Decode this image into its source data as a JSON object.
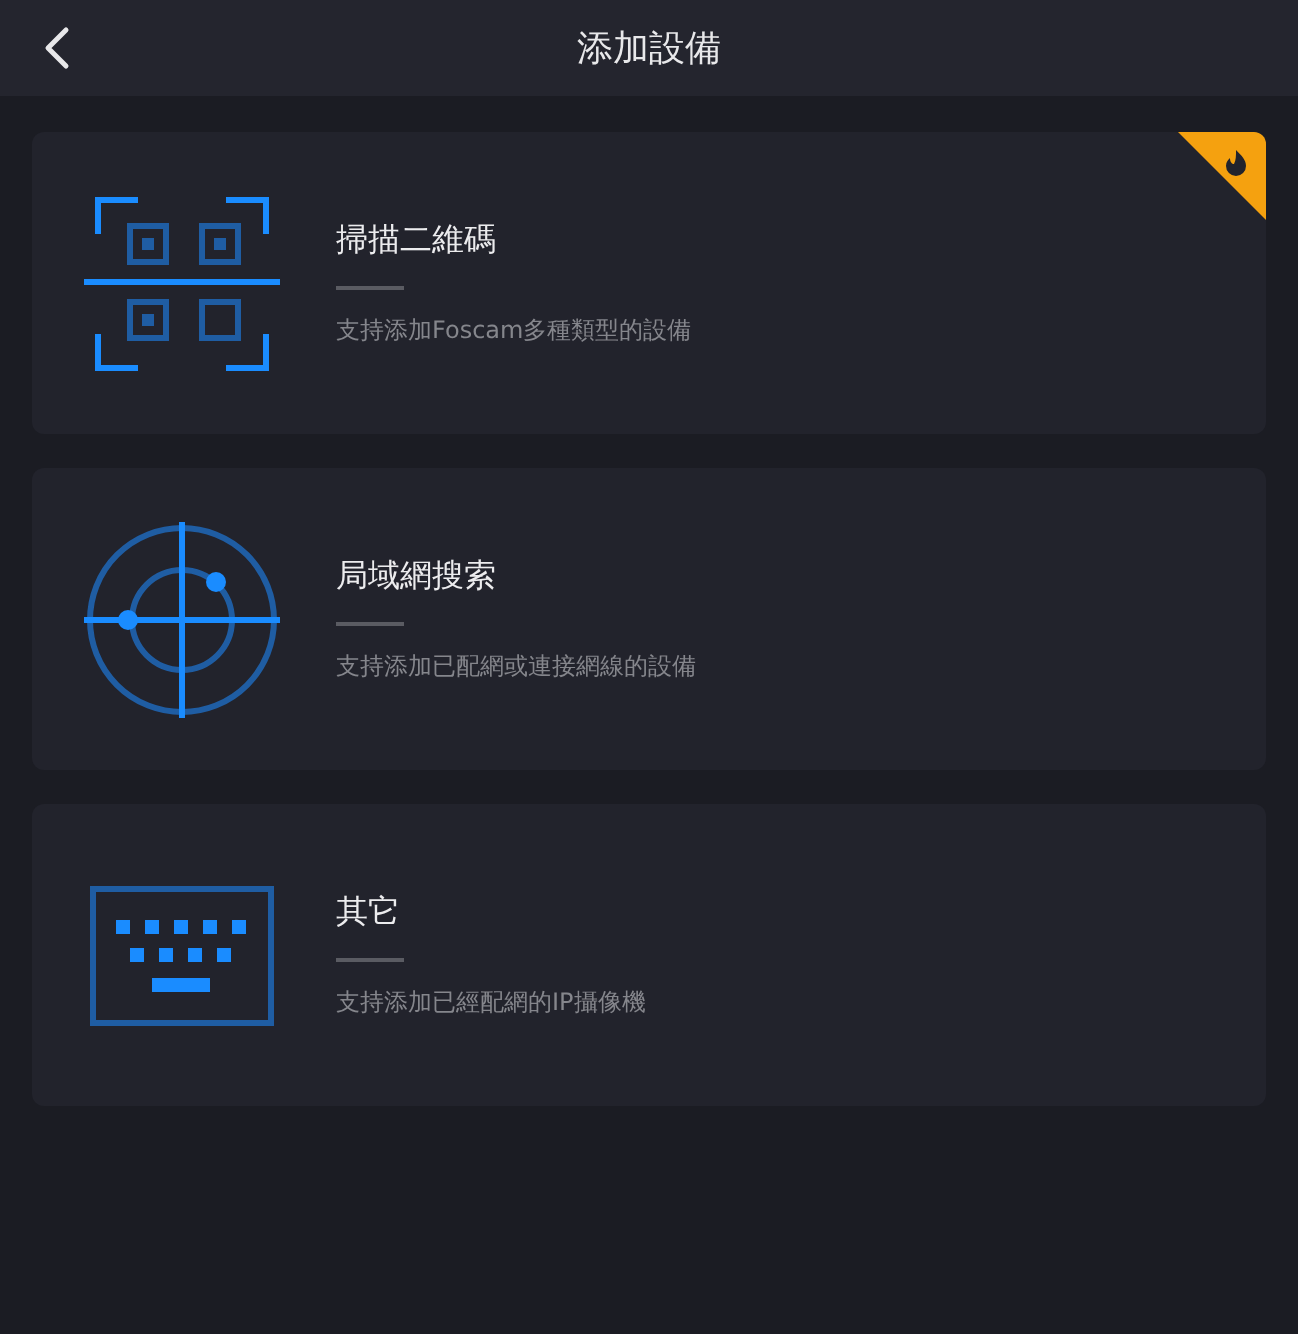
{
  "header": {
    "title": "添加設備"
  },
  "options": [
    {
      "kind": "qr",
      "title": "掃描二維碼",
      "description": "支持添加Foscam多種類型的設備",
      "hot": true
    },
    {
      "kind": "radar",
      "title": "局域網搜索",
      "description": "支持添加已配網或連接網線的設備",
      "hot": false
    },
    {
      "kind": "keyboard",
      "title": "其它",
      "description": "支持添加已經配網的IP攝像機",
      "hot": false
    }
  ]
}
